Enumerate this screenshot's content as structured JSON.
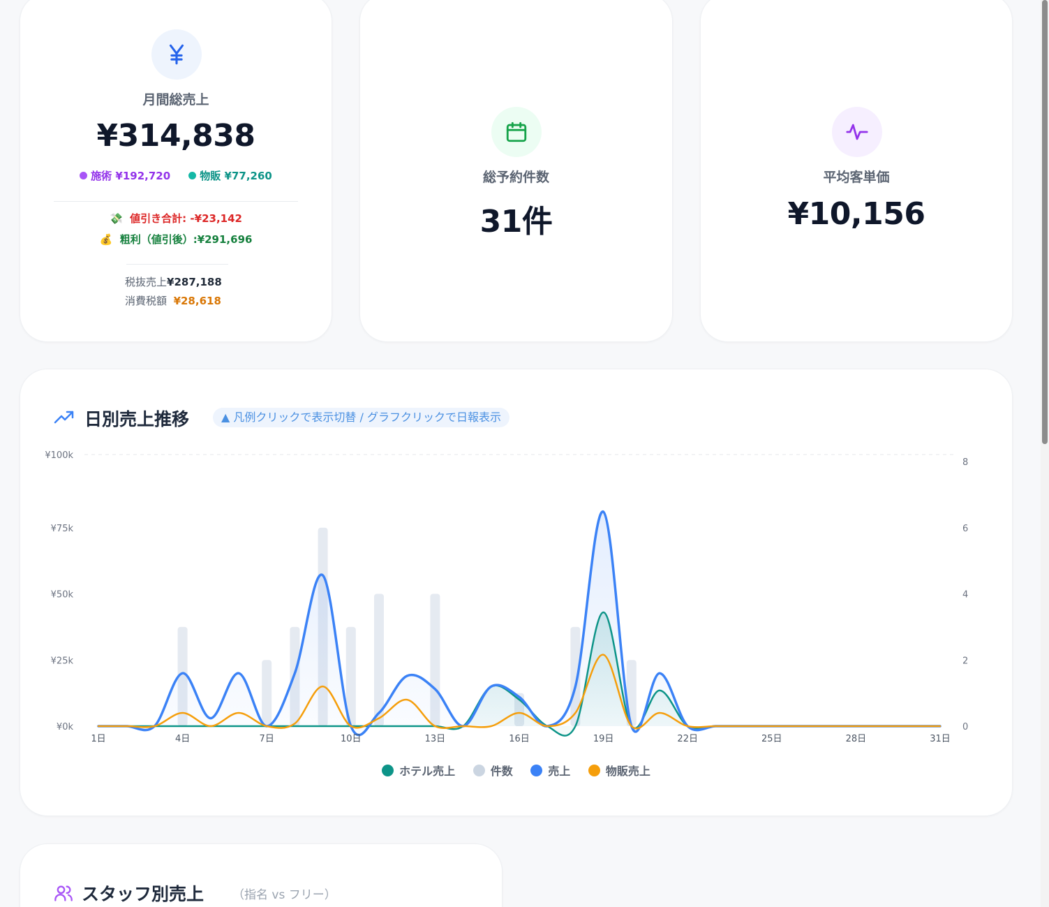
{
  "kpi": {
    "sales": {
      "label": "月間総売上",
      "value": "¥314,838",
      "treatment_label": "施術",
      "treatment_value": "¥192,720",
      "retail_label": "物販",
      "retail_value": "¥77,260",
      "discount_label": "値引き合計:",
      "discount_value": "-¥23,142",
      "profit_label": "粗利（値引後）:",
      "profit_value": "¥291,696",
      "pretax_label": "税抜売上",
      "pretax_value": "¥287,188",
      "tax_label": "消費税額",
      "tax_value": "¥28,618",
      "icon": "yen-icon"
    },
    "bookings": {
      "label": "総予約件数",
      "value": "31件",
      "icon": "calendar-icon"
    },
    "avg_price": {
      "label": "平均客単価",
      "value": "¥10,156",
      "icon": "activity-icon"
    }
  },
  "colors": {
    "treatment": "#9333ea",
    "retail": "#0d9488",
    "discount": "#dc2626",
    "profit": "#15803d",
    "tax": "#d97706",
    "blue": "#3b82f6",
    "hotel": "#0d9488",
    "count": "#cbd5e1",
    "goods": "#f59e0b"
  },
  "daily_chart": {
    "title": "日別売上推移",
    "hint": "▲ 凡例クリックで表示切替 / グラフクリックで日報表示",
    "legend": [
      {
        "name": "ホテル売上",
        "color": "#0d9488"
      },
      {
        "name": "件数",
        "color": "#cbd5e1"
      },
      {
        "name": "売上",
        "color": "#3b82f6"
      },
      {
        "name": "物販売上",
        "color": "#f59e0b"
      }
    ]
  },
  "chart_data": {
    "type": "line",
    "x": [
      1,
      2,
      3,
      4,
      5,
      6,
      7,
      8,
      9,
      10,
      11,
      12,
      13,
      14,
      15,
      16,
      17,
      18,
      19,
      20,
      21,
      22,
      23,
      24,
      25,
      26,
      27,
      28,
      29,
      30,
      31
    ],
    "x_tick_labels": [
      "1日",
      "4日",
      "7日",
      "10日",
      "13日",
      "16日",
      "19日",
      "22日",
      "25日",
      "28日",
      "31日"
    ],
    "y_left_ticks": [
      "¥0k",
      "¥25k",
      "¥50k",
      "¥75k",
      "¥100k"
    ],
    "y_left_range": [
      0,
      100000
    ],
    "y_right_ticks": [
      "0",
      "2",
      "4",
      "6",
      "8"
    ],
    "y_right_range": [
      0,
      8
    ],
    "grid": false,
    "legend_position": "bottom",
    "series": [
      {
        "name": "ホテル売上",
        "type": "area",
        "axis": "left",
        "values": [
          0,
          0,
          0,
          0,
          0,
          0,
          0,
          0,
          0,
          0,
          0,
          0,
          0,
          0,
          15000,
          10000,
          0,
          0,
          43000,
          0,
          13500,
          0,
          0,
          0,
          0,
          0,
          0,
          0,
          0,
          0,
          0
        ]
      },
      {
        "name": "件数",
        "type": "bar",
        "axis": "right",
        "values": [
          0,
          0,
          0,
          3,
          0,
          0,
          2,
          3,
          6,
          3,
          4,
          0,
          4,
          0,
          0,
          1,
          0,
          3,
          0,
          2,
          0,
          0,
          0,
          0,
          0,
          0,
          0,
          0,
          0,
          0,
          0
        ]
      },
      {
        "name": "売上",
        "type": "area",
        "axis": "left",
        "values": [
          0,
          0,
          0,
          20000,
          3000,
          20000,
          0,
          20000,
          57000,
          0,
          5000,
          19000,
          14000,
          0,
          15000,
          11000,
          0,
          15000,
          81000,
          0,
          20000,
          0,
          0,
          0,
          0,
          0,
          0,
          0,
          0,
          0,
          0
        ]
      },
      {
        "name": "物販売上",
        "type": "line",
        "axis": "left",
        "values": [
          0,
          0,
          0,
          5000,
          0,
          5000,
          0,
          1000,
          15000,
          0,
          3000,
          10000,
          0,
          0,
          0,
          5000,
          0,
          5000,
          27000,
          0,
          5000,
          0,
          0,
          0,
          0,
          0,
          0,
          0,
          0,
          0,
          0
        ]
      }
    ]
  },
  "staff": {
    "title": "スタッフ別売上",
    "subtitle": "（指名 vs フリー）"
  }
}
